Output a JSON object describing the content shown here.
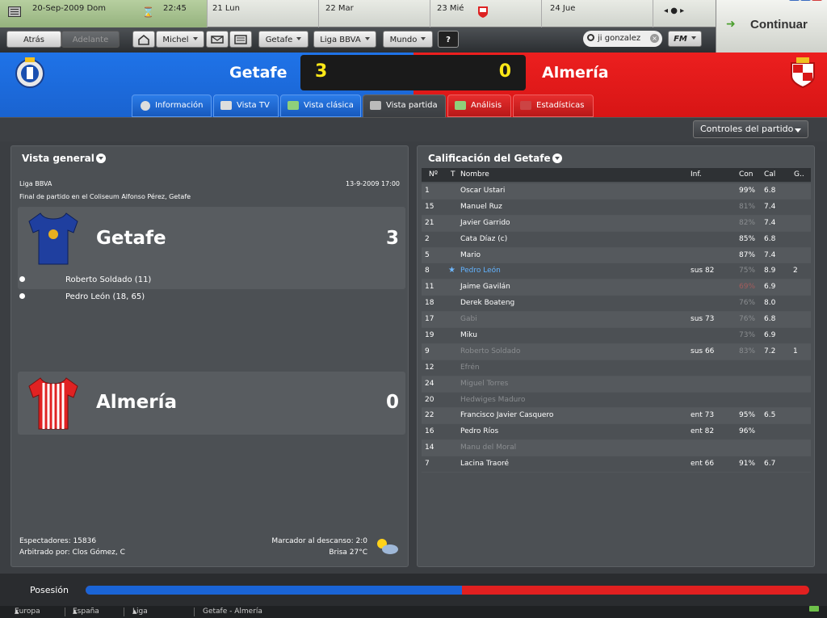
{
  "calendar": {
    "current_date": "20-Sep-2009",
    "current_day": "Dom",
    "time": "22:45",
    "days": [
      "21 Lun",
      "22 Mar",
      "23 Mié",
      "24 Jue"
    ]
  },
  "continue_label": "Continuar",
  "nav": {
    "back": "Atrás",
    "forward": "Adelante",
    "manager": "Michel",
    "club": "Getafe",
    "league": "Liga BBVA",
    "world": "Mundo",
    "help": "?",
    "search_value": "ji gonzalez",
    "fm_label": "FM"
  },
  "match": {
    "home_team": "Getafe",
    "away_team": "Almería",
    "home_score": "3",
    "away_score": "0"
  },
  "tabs": [
    "Información",
    "Vista TV",
    "Vista clásica",
    "Vista partida",
    "Análisis",
    "Estadísticas"
  ],
  "match_controls": "Controles del partido",
  "overview": {
    "title": "Vista general",
    "competition": "Liga BBVA",
    "datetime": "13-9-2009 17:00",
    "venue": "Final de partido en el Coliseum Alfonso Pérez, Getafe",
    "home_team": "Getafe",
    "home_score": "3",
    "home_goals": [
      "Roberto Soldado (11)",
      "Pedro León (18, 65)"
    ],
    "away_team": "Almería",
    "away_score": "0",
    "attendance": "Espectadores: 15836",
    "referee": "Arbitrado por: Clos Gómez, C",
    "halftime": "Marcador al descanso: 2:0",
    "weather": "Brisa 27°C"
  },
  "ratings": {
    "title": "Calificación del Getafe",
    "headers": {
      "no": "Nº",
      "t": "T",
      "name": "Nombre",
      "inf": "Inf.",
      "con": "Con",
      "cal": "Cal",
      "g": "G.."
    },
    "rows": [
      {
        "no": "1",
        "name": "Oscar Ustari",
        "inf": "",
        "con": "99%",
        "cal": "6.8",
        "g": ""
      },
      {
        "no": "15",
        "name": "Manuel Ruz",
        "inf": "",
        "con": "81%",
        "cal": "7.4",
        "g": ""
      },
      {
        "no": "21",
        "name": "Javier Garrido",
        "inf": "",
        "con": "82%",
        "cal": "7.4",
        "g": ""
      },
      {
        "no": "2",
        "name": "Cata Díaz (c)",
        "inf": "",
        "con": "85%",
        "cal": "6.8",
        "g": ""
      },
      {
        "no": "5",
        "name": "Mario",
        "inf": "",
        "con": "87%",
        "cal": "7.4",
        "g": ""
      },
      {
        "no": "8",
        "name": "Pedro León",
        "inf": "sus 82",
        "con": "75%",
        "cal": "8.9",
        "g": "2"
      },
      {
        "no": "11",
        "name": "Jaime Gavilán",
        "inf": "",
        "con": "69%",
        "cal": "6.9",
        "g": ""
      },
      {
        "no": "18",
        "name": "Derek Boateng",
        "inf": "",
        "con": "76%",
        "cal": "8.0",
        "g": ""
      },
      {
        "no": "17",
        "name": "Gabi",
        "inf": "sus 73",
        "con": "76%",
        "cal": "6.8",
        "g": ""
      },
      {
        "no": "19",
        "name": "Miku",
        "inf": "",
        "con": "73%",
        "cal": "6.9",
        "g": ""
      },
      {
        "no": "9",
        "name": "Roberto Soldado",
        "inf": "sus 66",
        "con": "83%",
        "cal": "7.2",
        "g": "1"
      },
      {
        "no": "12",
        "name": "Efrén",
        "inf": "",
        "con": "",
        "cal": "",
        "g": ""
      },
      {
        "no": "24",
        "name": "Miguel Torres",
        "inf": "",
        "con": "",
        "cal": "",
        "g": ""
      },
      {
        "no": "20",
        "name": "Hedwiges Maduro",
        "inf": "",
        "con": "",
        "cal": "",
        "g": ""
      },
      {
        "no": "22",
        "name": "Francisco Javier Casquero",
        "inf": "ent 73",
        "con": "95%",
        "cal": "6.5",
        "g": ""
      },
      {
        "no": "16",
        "name": "Pedro Ríos",
        "inf": "ent 82",
        "con": "96%",
        "cal": "",
        "g": ""
      },
      {
        "no": "14",
        "name": "Manu del Moral",
        "inf": "",
        "con": "",
        "cal": "",
        "g": ""
      },
      {
        "no": "7",
        "name": "Lacina Traoré",
        "inf": "ent 66",
        "con": "91%",
        "cal": "6.7",
        "g": ""
      }
    ]
  },
  "possession": {
    "label": "Posesión",
    "home_fraction": 0.52
  },
  "breadcrumbs": [
    "Europa",
    "España",
    "Liga BBVA",
    "Getafe - Almería"
  ],
  "colors": {
    "home": "#1f73e8",
    "away": "#ec1f1f",
    "score": "#ffe817"
  }
}
